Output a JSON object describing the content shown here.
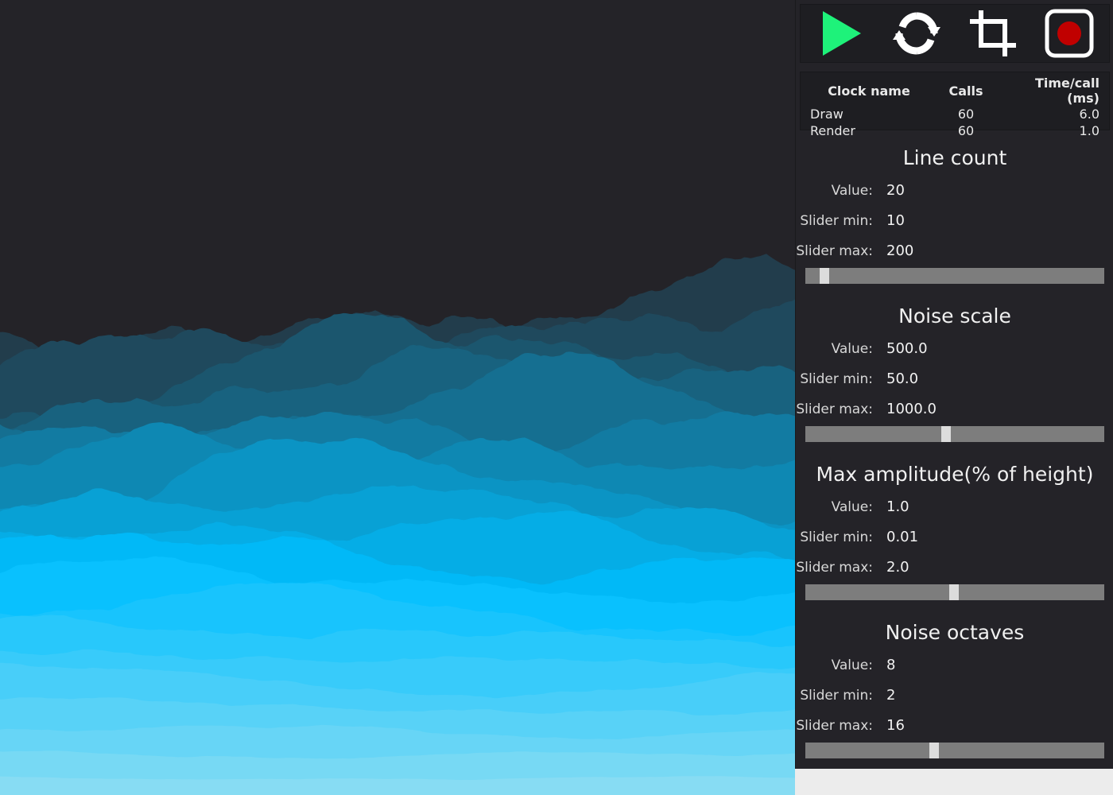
{
  "toolbar": {
    "icons": [
      "play-icon",
      "refresh-icon",
      "crop-icon",
      "record-icon"
    ],
    "colors": {
      "play": "#1ef27a",
      "record": "#c00000"
    }
  },
  "clocks": {
    "headers": {
      "name": "Clock name",
      "calls": "Calls",
      "time": "Time/call (ms)"
    },
    "rows": [
      {
        "name": "Draw",
        "calls": "60",
        "time": "6.0"
      },
      {
        "name": "Render",
        "calls": "60",
        "time": "1.0"
      }
    ]
  },
  "labels": {
    "value": "Value:",
    "min": "Slider min:",
    "max": "Slider max:"
  },
  "params": [
    {
      "title": "Line count",
      "value": "20",
      "min": "10",
      "max": "200",
      "position": 0.063
    },
    {
      "title": "Noise scale",
      "value": "500.0",
      "min": "50.0",
      "max": "1000.0",
      "position": 0.471
    },
    {
      "title": "Max amplitude(% of height)",
      "value": "1.0",
      "min": "0.01",
      "max": "2.0",
      "position": 0.497
    },
    {
      "title": "Noise octaves",
      "value": "8",
      "min": "2",
      "max": "16",
      "position": 0.431
    }
  ],
  "colors": {
    "background": "#242328",
    "back_layer": "#223d4c",
    "front_layer": "#87dcf3",
    "accent": "#00bfff"
  }
}
